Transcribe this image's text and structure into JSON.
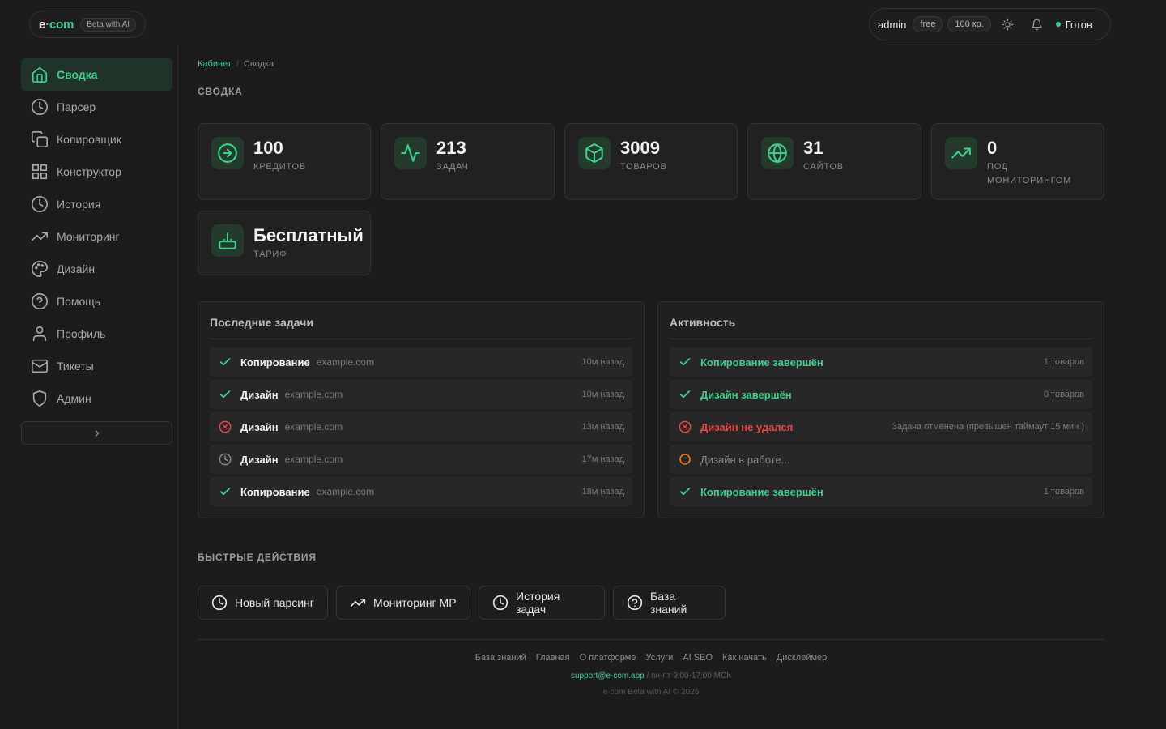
{
  "brand": {
    "logo_main": "e",
    "logo_accent": "·com",
    "badge": "Beta with AI"
  },
  "topbar": {
    "user": "admin",
    "plan_pill": "free",
    "credits_pill": "100 кр.",
    "theme_icon": "sun-icon",
    "notifications_icon": "bell-icon",
    "status": "Готов"
  },
  "sidebar": {
    "items": [
      {
        "label": "Сводка",
        "icon": "home-icon",
        "active": true
      },
      {
        "label": "Парсер",
        "icon": "clock-icon"
      },
      {
        "label": "Копировщик",
        "icon": "copy-icon"
      },
      {
        "label": "Конструктор",
        "icon": "grid-icon"
      },
      {
        "label": "История",
        "icon": "clock-icon"
      },
      {
        "label": "Мониторинг",
        "icon": "trending-up-icon"
      },
      {
        "label": "Дизайн",
        "icon": "palette-icon"
      },
      {
        "label": "Помощь",
        "icon": "help-circle-icon"
      },
      {
        "label": "Профиль",
        "icon": "user-icon"
      },
      {
        "label": "Тикеты",
        "icon": "mail-icon"
      },
      {
        "label": "Админ",
        "icon": "shield-icon"
      }
    ],
    "collapse_icon": "chevron-right-icon"
  },
  "breadcrumb": {
    "root": "Кабинет",
    "sep": "/",
    "current": "Сводка"
  },
  "summary_title": "СВОДКА",
  "stats": [
    {
      "value": "100",
      "label": "КРЕДИТОВ",
      "icon": "arrow-circle-icon"
    },
    {
      "value": "213",
      "label": "ЗАДАЧ",
      "icon": "activity-icon"
    },
    {
      "value": "3009",
      "label": "ТОВАРОВ",
      "icon": "box-icon"
    },
    {
      "value": "31",
      "label": "САЙТОВ",
      "icon": "globe-icon"
    },
    {
      "value": "0",
      "label": "ПОД МОНИТОРИНГОМ",
      "icon": "trending-up-icon"
    },
    {
      "value": "Бесплатный",
      "label": "ТАРИФ",
      "icon": "tariff-icon"
    }
  ],
  "recent_tasks": {
    "title": "Последние задачи",
    "rows": [
      {
        "status": "done",
        "name": "Копирование",
        "site": "example.com",
        "time": "10м назад"
      },
      {
        "status": "done",
        "name": "Дизайн",
        "site": "example.com",
        "time": "10м назад"
      },
      {
        "status": "error",
        "name": "Дизайн",
        "site": "example.com",
        "time": "13м назад"
      },
      {
        "status": "pending",
        "name": "Дизайн",
        "site": "example.com",
        "time": "17м назад"
      },
      {
        "status": "done",
        "name": "Копирование",
        "site": "example.com",
        "time": "18м назад"
      }
    ]
  },
  "activity": {
    "title": "Активность",
    "rows": [
      {
        "status": "done",
        "text": "Копирование завершён",
        "meta": "1 товаров"
      },
      {
        "status": "done",
        "text": "Дизайн завершён",
        "meta": "0 товаров"
      },
      {
        "status": "error",
        "text": "Дизайн не удался",
        "meta": "Задача отменена (превышен таймаут 15 мин.)"
      },
      {
        "status": "running",
        "text": "Дизайн в работе...",
        "meta": ""
      },
      {
        "status": "done",
        "text": "Копирование завершён",
        "meta": "1 товаров"
      }
    ]
  },
  "quick_actions": {
    "title": "БЫСТРЫЕ ДЕЙСТВИЯ",
    "buttons": [
      {
        "label": "Новый парсинг",
        "icon": "clock-icon"
      },
      {
        "label": "Мониторинг МР",
        "icon": "trending-up-icon"
      },
      {
        "label": "История задач",
        "icon": "clock-icon"
      },
      {
        "label": "База знаний",
        "icon": "help-circle-icon"
      }
    ]
  },
  "footer": {
    "links": [
      "База знаний",
      "Главная",
      "О платформе",
      "Услуги",
      "AI SEO",
      "Как начать",
      "Дисклеймер"
    ],
    "email": "support@e-com.app",
    "hours": " / пн-пт 9:00-17:00 МСК",
    "copyright": "e·com Beta with AI © 2026"
  },
  "colors": {
    "accent": "#3fcf8e",
    "error": "#ef4444",
    "warning": "#f97316",
    "background": "#1c1c1c"
  }
}
